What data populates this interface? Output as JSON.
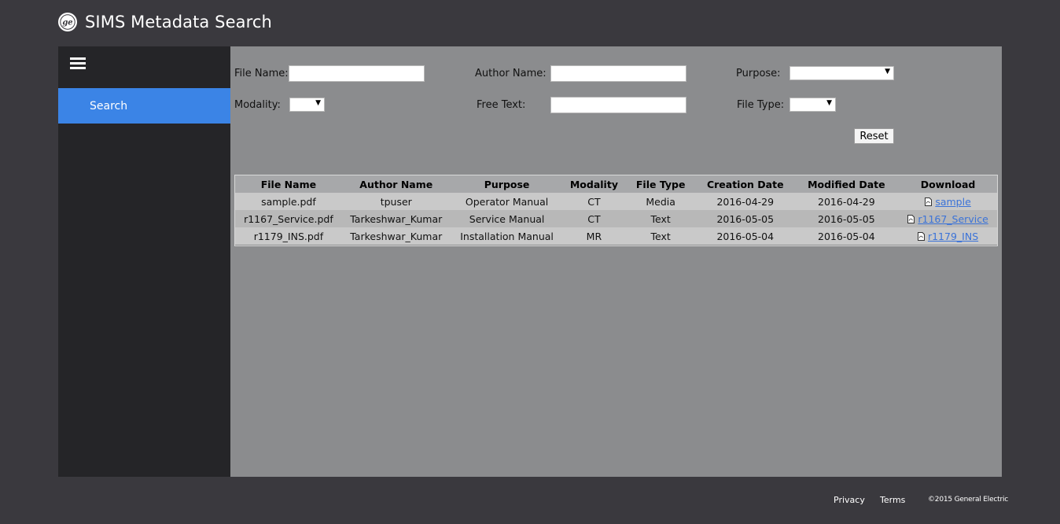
{
  "header": {
    "title": "SIMS Metadata Search",
    "logo_icon": "ge-logo-icon"
  },
  "sidebar": {
    "menu_icon": "hamburger-icon",
    "items": [
      {
        "label": "Search",
        "active": true
      }
    ]
  },
  "form": {
    "file_name_label": "File Name:",
    "author_name_label": "Author Name:",
    "purpose_label": "Purpose:",
    "modality_label": "Modality:",
    "free_text_label": "Free Text:",
    "file_type_label": "File Type:",
    "file_name_value": "",
    "author_name_value": "",
    "free_text_value": "",
    "purpose_selected": "",
    "modality_selected": "",
    "file_type_selected": "",
    "reset_label": "Reset"
  },
  "table": {
    "columns": [
      "File Name",
      "Author Name",
      "Purpose",
      "Modality",
      "File Type",
      "Creation Date",
      "Modified Date",
      "Download"
    ],
    "rows": [
      {
        "file_name": "sample.pdf",
        "author": "tpuser",
        "purpose": "Operator Manual",
        "modality": "CT",
        "file_type": "Media",
        "created": "2016-04-29",
        "modified": "2016-04-29",
        "download": "sample"
      },
      {
        "file_name": "r1167_Service.pdf",
        "author": "Tarkeshwar_Kumar",
        "purpose": "Service Manual",
        "modality": "CT",
        "file_type": "Text",
        "created": "2016-05-05",
        "modified": "2016-05-05",
        "download": "r1167_Service"
      },
      {
        "file_name": "r1179_INS.pdf",
        "author": "Tarkeshwar_Kumar",
        "purpose": "Installation Manual",
        "modality": "MR",
        "file_type": "Text",
        "created": "2016-05-04",
        "modified": "2016-05-04",
        "download": "r1179_INS"
      }
    ]
  },
  "footer": {
    "privacy": "Privacy",
    "terms": "Terms",
    "copyright": "©2015 General Electric"
  },
  "colors": {
    "background": "#3a393e",
    "sidebar": "#252528",
    "accent": "#3b84e6",
    "panel": "#8b8c8e",
    "link": "#3b73d8"
  }
}
